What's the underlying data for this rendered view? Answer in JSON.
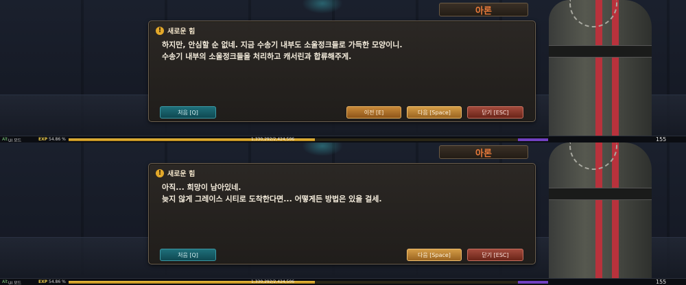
{
  "panels": [
    {
      "npc_name": "아론",
      "quest_title": "새로운 힘",
      "dialog_lines": [
        "하지만, 안심할 순 없네. 지금 수송기 내부도 소울정크들로 가득한 모양이니.",
        "수송기 내부의 소울정크들을 처리하고 캐서린과 합류해주게."
      ],
      "buttons": {
        "first": "처음 [Q]",
        "prev": "이전 [E]",
        "next": "다음 [Space]",
        "close": "닫기 [ESC]"
      },
      "show_prev": true,
      "hud": {
        "alt_key": "Alt",
        "ui_mode": "UI 모드",
        "exp_label": "EXP",
        "exp_percent": "54.86 %",
        "exp_fraction": 0.5486,
        "exp_value": "1,330,292/2,424,506",
        "level": "155"
      }
    },
    {
      "npc_name": "아론",
      "quest_title": "새로운 힘",
      "dialog_lines": [
        "아직... 희망이 남아있네.",
        "늦지 않게 그레이스 시티로 도착한다면... 어떻게든 방법은 있을 걸세."
      ],
      "buttons": {
        "first": "처음 [Q]",
        "prev": "",
        "next": "다음 [Space]",
        "close": "닫기 [ESC]"
      },
      "show_prev": false,
      "hud": {
        "alt_key": "Alt",
        "ui_mode": "UI 모드",
        "exp_label": "EXP",
        "exp_percent": "54.86 %",
        "exp_fraction": 0.5486,
        "exp_value": "1,330,292/2,424,506",
        "level": "155"
      }
    }
  ],
  "colors": {
    "npc_name": "#e87a3a",
    "dialog_text": "#f4ecdc",
    "exp_bar": "#f0c040",
    "btn_first": "#1f6f7a",
    "btn_prev": "#c8893a",
    "btn_next": "#d49c46",
    "btn_close": "#a24a3c"
  },
  "icons": {
    "quest": "exclamation-icon"
  }
}
